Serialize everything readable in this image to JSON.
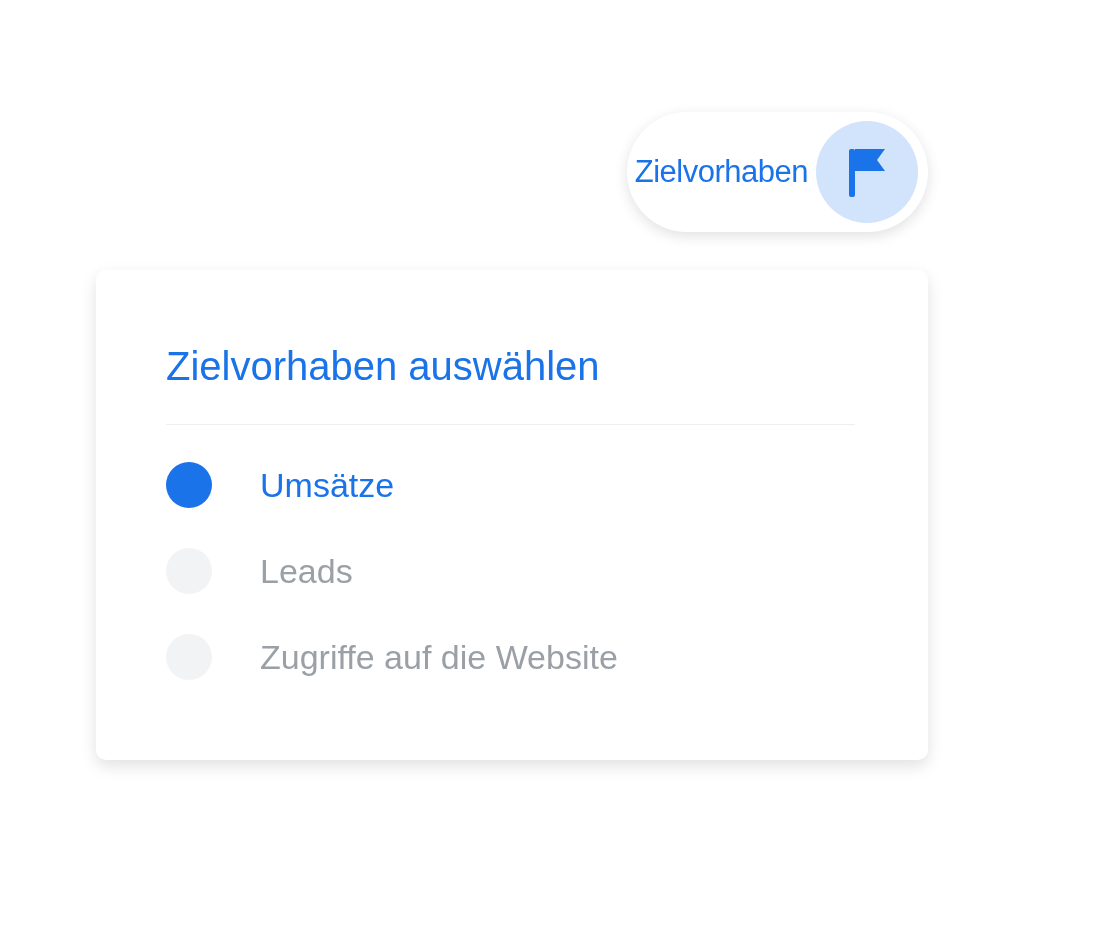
{
  "goal_chip": {
    "label": "Zielvorhaben"
  },
  "goal_card": {
    "title": "Zielvorhaben auswählen",
    "options": [
      {
        "label": "Umsätze",
        "selected": true
      },
      {
        "label": "Leads",
        "selected": false
      },
      {
        "label": "Zugriffe auf die Website",
        "selected": false
      }
    ]
  }
}
